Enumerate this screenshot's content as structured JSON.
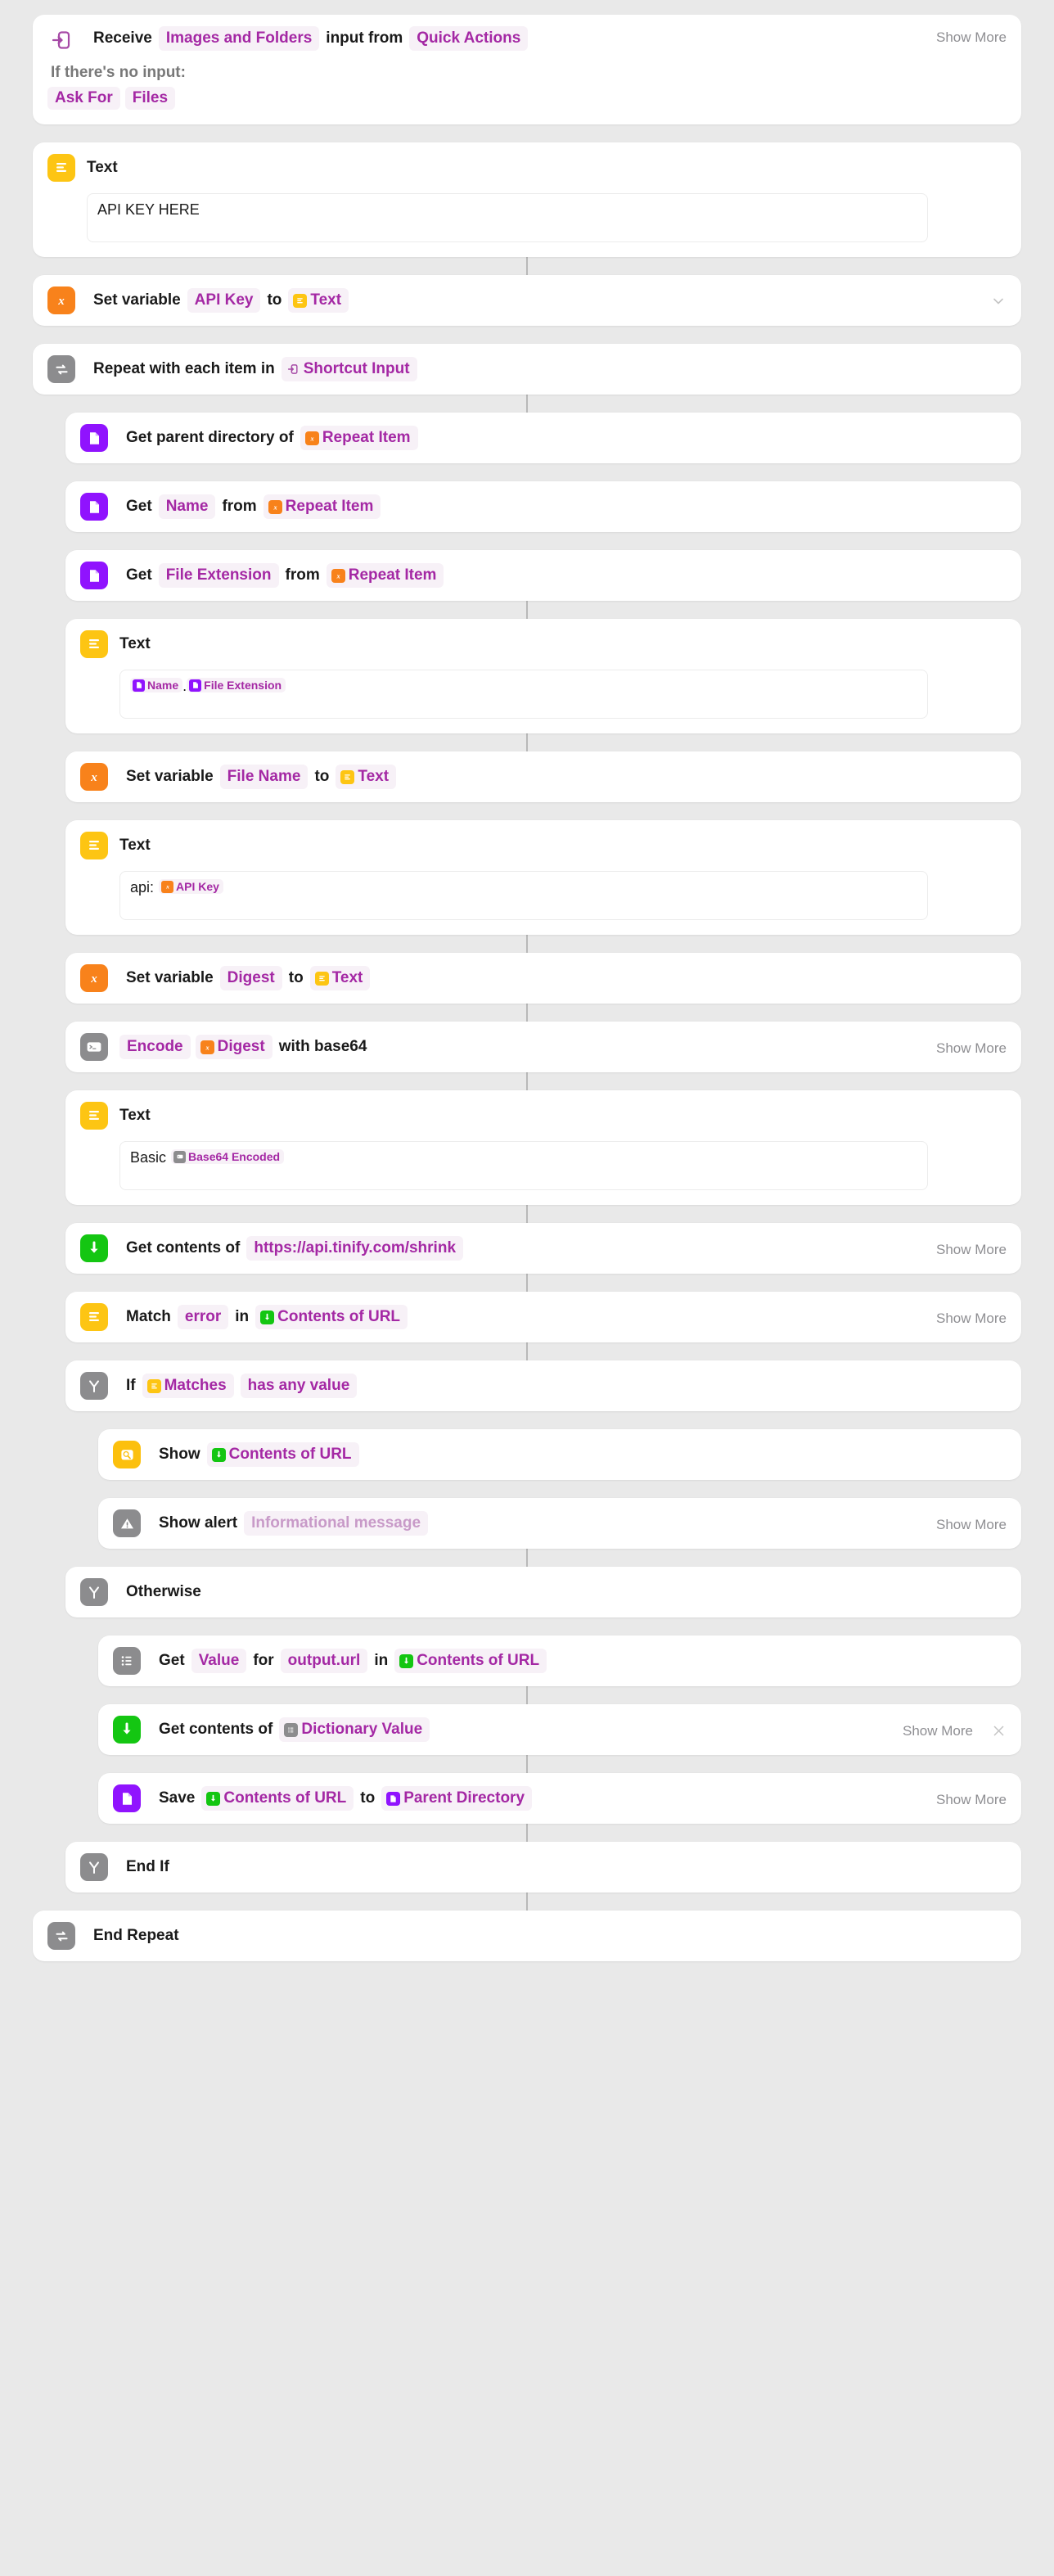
{
  "app": "Shortcuts Editor",
  "labels": {
    "show_more": "Show More"
  },
  "trigger": {
    "icon": "receive-input-icon",
    "word_receive": "Receive",
    "param_input_types": "Images and Folders",
    "word_input_from": "input from",
    "param_source": "Quick Actions",
    "no_input_label": "If there's no input:",
    "chip_ask_for": "Ask For",
    "chip_files": "Files",
    "show_more": "Show More"
  },
  "actions": [
    {
      "id": "text-api-key",
      "title": "Text",
      "field_value": "API KEY HERE"
    },
    {
      "id": "set-var-api-key",
      "w1": "Set variable",
      "p1": "API Key",
      "w2": "to",
      "t1": "Text"
    },
    {
      "id": "repeat-each",
      "w1": "Repeat with each item in",
      "t1": "Shortcut Input"
    },
    {
      "id": "get-parent-directory",
      "w1": "Get parent directory of",
      "t1": "Repeat Item"
    },
    {
      "id": "get-name",
      "w1": "Get",
      "p1": "Name",
      "w2": "from",
      "t1": "Repeat Item"
    },
    {
      "id": "get-file-extension",
      "w1": "Get",
      "p1": "File Extension",
      "w2": "from",
      "t1": "Repeat Item"
    },
    {
      "id": "text-filename",
      "title": "Text",
      "tok_a": "Name",
      "sep": ".",
      "tok_b": "File Extension"
    },
    {
      "id": "set-var-file-name",
      "w1": "Set variable",
      "p1": "File Name",
      "w2": "to",
      "t1": "Text"
    },
    {
      "id": "text-digest",
      "title": "Text",
      "prefix": "api:",
      "tok_a": "API Key"
    },
    {
      "id": "set-var-digest",
      "w1": "Set variable",
      "p1": "Digest",
      "w2": "to",
      "t1": "Text"
    },
    {
      "id": "encode-base64",
      "p1": "Encode",
      "t1": "Digest",
      "w2": "with base64",
      "show_more": "Show More"
    },
    {
      "id": "text-basic-auth",
      "title": "Text",
      "prefix": "Basic",
      "tok_a": "Base64 Encoded"
    },
    {
      "id": "get-contents-url",
      "w1": "Get contents of",
      "p1": "https://api.tinify.com/shrink",
      "show_more": "Show More"
    },
    {
      "id": "match-error",
      "w1": "Match",
      "p1": "error",
      "w2": "in",
      "t1": "Contents of URL",
      "show_more": "Show More"
    },
    {
      "id": "if-matches",
      "w1": "If",
      "t1": "Matches",
      "p2": "has any value"
    },
    {
      "id": "show-contents",
      "w1": "Show",
      "t1": "Contents of URL"
    },
    {
      "id": "show-alert",
      "w1": "Show alert",
      "p1": "Informational message",
      "show_more": "Show More"
    },
    {
      "id": "otherwise",
      "w1": "Otherwise"
    },
    {
      "id": "get-dict-value",
      "w1": "Get",
      "p1": "Value",
      "w2": "for",
      "p2": "output.url",
      "w3": "in",
      "t1": "Contents of URL"
    },
    {
      "id": "get-contents-dict",
      "w1": "Get contents of",
      "t1": "Dictionary Value",
      "show_more": "Show More",
      "close": "×"
    },
    {
      "id": "save-file",
      "w1": "Save",
      "t1": "Contents of URL",
      "w2": "to",
      "t2": "Parent Directory",
      "show_more": "Show More"
    },
    {
      "id": "end-if",
      "w1": "End If"
    },
    {
      "id": "end-repeat",
      "w1": "End Repeat"
    }
  ],
  "colors": {
    "accent_purple": "#a428a4",
    "icon_yellow": "#fdc513",
    "icon_orange": "#f8821b",
    "icon_purple": "#9013fe",
    "icon_gray": "#8c8c8e",
    "icon_green": "#14c612",
    "background": "#e9e9e9"
  }
}
